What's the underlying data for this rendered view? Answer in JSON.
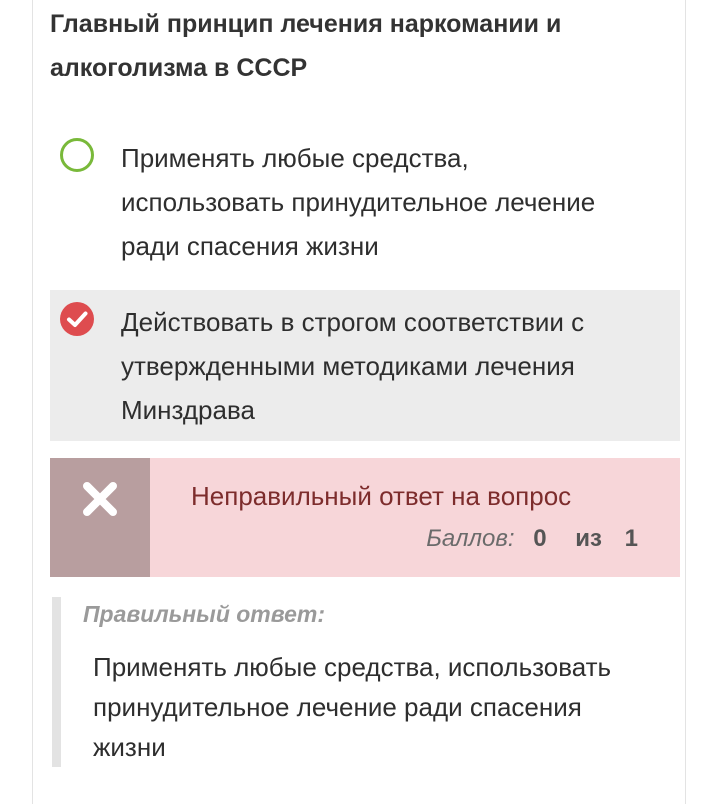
{
  "question": {
    "line1": "Главный принцип лечения наркомании и",
    "line2": "алкоголизма в СССР"
  },
  "options": [
    {
      "lines": [
        "Применять любые средства,",
        "использовать принудительное лечение",
        "ради спасения жизни"
      ],
      "selected": false
    },
    {
      "lines": [
        "Действовать в строгом соответствии с",
        "утвержденными методиками лечения",
        "Минздрава"
      ],
      "selected": true
    }
  ],
  "result": {
    "message": "Неправильный ответ на вопрос",
    "score_label": "Баллов:",
    "score_value": "0",
    "score_of": "из",
    "score_max": "1"
  },
  "correct_answer": {
    "title": "Правильный ответ:",
    "lines": [
      "Применять любые средства, использовать",
      "принудительное лечение ради спасения",
      "жизни"
    ]
  },
  "colors": {
    "radio_outline": "#79b93a",
    "selected_wrong": "#de4c4f",
    "result_bg": "#f7d6d9",
    "result_icon_bg": "#b89e9f"
  },
  "icons": {
    "option_unselected": "radio-empty-icon",
    "option_selected": "check-circle-icon",
    "result": "close-icon"
  }
}
